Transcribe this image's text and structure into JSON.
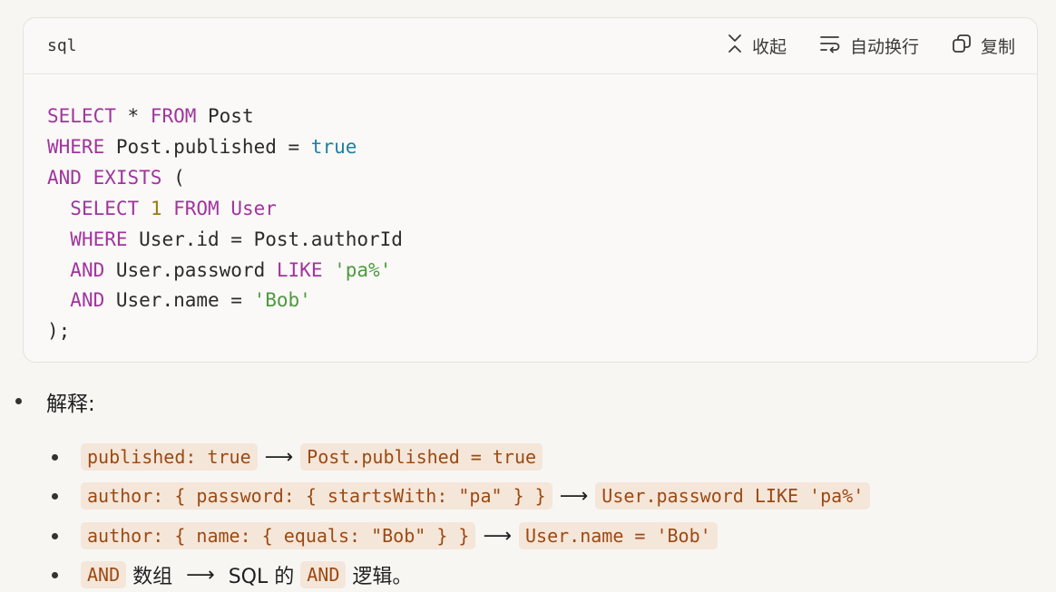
{
  "code_block": {
    "language": "sql",
    "actions": {
      "collapse": "收起",
      "wrap": "自动换行",
      "copy": "复制"
    }
  },
  "code_lines": [
    [
      {
        "t": "SELECT",
        "c": "kw"
      },
      {
        "t": " * ",
        "c": ""
      },
      {
        "t": "FROM",
        "c": "kw"
      },
      {
        "t": " Post",
        "c": ""
      }
    ],
    [
      {
        "t": "WHERE",
        "c": "kw"
      },
      {
        "t": " Post.published = ",
        "c": ""
      },
      {
        "t": "true",
        "c": "bool"
      }
    ],
    [
      {
        "t": "AND",
        "c": "kw"
      },
      {
        "t": " ",
        "c": ""
      },
      {
        "t": "EXISTS",
        "c": "kw"
      },
      {
        "t": " (",
        "c": ""
      }
    ],
    [
      {
        "t": "  ",
        "c": ""
      },
      {
        "t": "SELECT",
        "c": "kw"
      },
      {
        "t": " ",
        "c": ""
      },
      {
        "t": "1",
        "c": "num"
      },
      {
        "t": " ",
        "c": ""
      },
      {
        "t": "FROM",
        "c": "kw"
      },
      {
        "t": " ",
        "c": ""
      },
      {
        "t": "User",
        "c": "kw"
      }
    ],
    [
      {
        "t": "  ",
        "c": ""
      },
      {
        "t": "WHERE",
        "c": "kw"
      },
      {
        "t": " User.id = Post.authorId",
        "c": ""
      }
    ],
    [
      {
        "t": "  ",
        "c": ""
      },
      {
        "t": "AND",
        "c": "kw"
      },
      {
        "t": " User.password ",
        "c": ""
      },
      {
        "t": "LIKE",
        "c": "kw"
      },
      {
        "t": " ",
        "c": ""
      },
      {
        "t": "'pa%'",
        "c": "str"
      }
    ],
    [
      {
        "t": "  ",
        "c": ""
      },
      {
        "t": "AND",
        "c": "kw"
      },
      {
        "t": " User.name = ",
        "c": ""
      },
      {
        "t": "'Bob'",
        "c": "str"
      }
    ],
    [
      {
        "t": ");",
        "c": ""
      }
    ]
  ],
  "explanation": {
    "title": "解释:",
    "items": [
      {
        "parts": [
          {
            "type": "code",
            "text": "published: true"
          },
          {
            "type": "arrow",
            "text": "⟶"
          },
          {
            "type": "code",
            "text": "Post.published = true"
          }
        ]
      },
      {
        "parts": [
          {
            "type": "code",
            "text": "author: { password: { startsWith: \"pa\" } }"
          },
          {
            "type": "arrow",
            "text": "⟶"
          },
          {
            "type": "code",
            "text": "User.password LIKE 'pa%'"
          }
        ]
      },
      {
        "parts": [
          {
            "type": "code",
            "text": "author: { name: { equals: \"Bob\" } }"
          },
          {
            "type": "arrow",
            "text": "⟶"
          },
          {
            "type": "code",
            "text": "User.name = 'Bob'"
          }
        ]
      },
      {
        "parts": [
          {
            "type": "code",
            "text": "AND"
          },
          {
            "type": "text",
            "text": "数组"
          },
          {
            "type": "arrow",
            "text": "⟶"
          },
          {
            "type": "text",
            "text": "SQL 的"
          },
          {
            "type": "code",
            "text": "AND"
          },
          {
            "type": "text",
            "text": "逻辑。"
          }
        ]
      }
    ]
  }
}
